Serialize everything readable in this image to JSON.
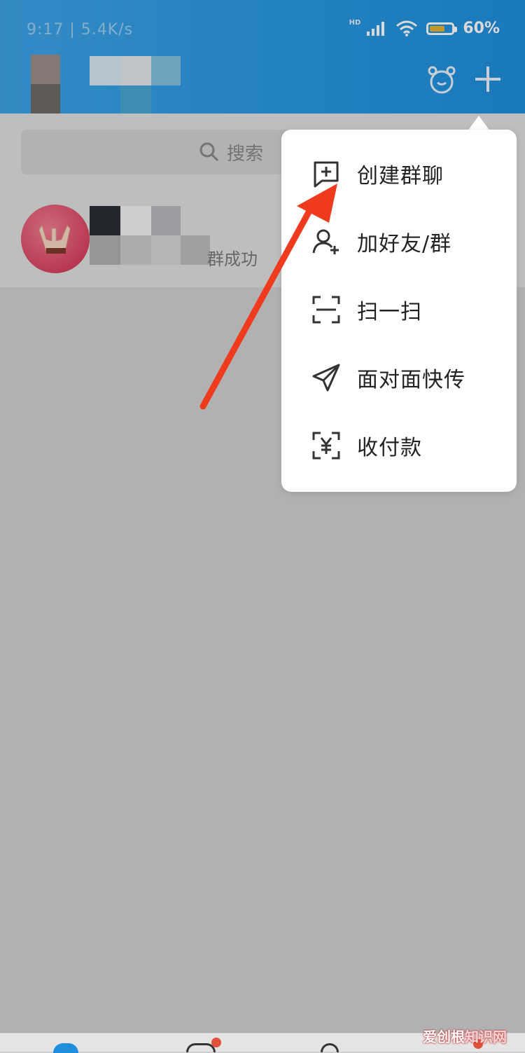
{
  "status_bar": {
    "time": "9:17 | 5.4K/s",
    "network_label": "HD",
    "battery_percent": "60%",
    "battery_level": 0.6
  },
  "search": {
    "placeholder": "搜索"
  },
  "chat_list": {
    "items": [
      {
        "preview": "群成功"
      }
    ]
  },
  "menu": {
    "items": [
      {
        "label": "创建群聊",
        "icon": "chat-plus-icon"
      },
      {
        "label": "加好友/群",
        "icon": "add-friend-icon"
      },
      {
        "label": "扫一扫",
        "icon": "scan-icon"
      },
      {
        "label": "面对面快传",
        "icon": "paper-plane-icon"
      },
      {
        "label": "收付款",
        "icon": "payment-icon"
      }
    ]
  },
  "watermark": {
    "main": "爱创根",
    "accent": "知识网"
  },
  "colors": {
    "header": "#2a9ae2",
    "annotation_arrow": "#f03a1e",
    "badge": "#e0523c"
  }
}
